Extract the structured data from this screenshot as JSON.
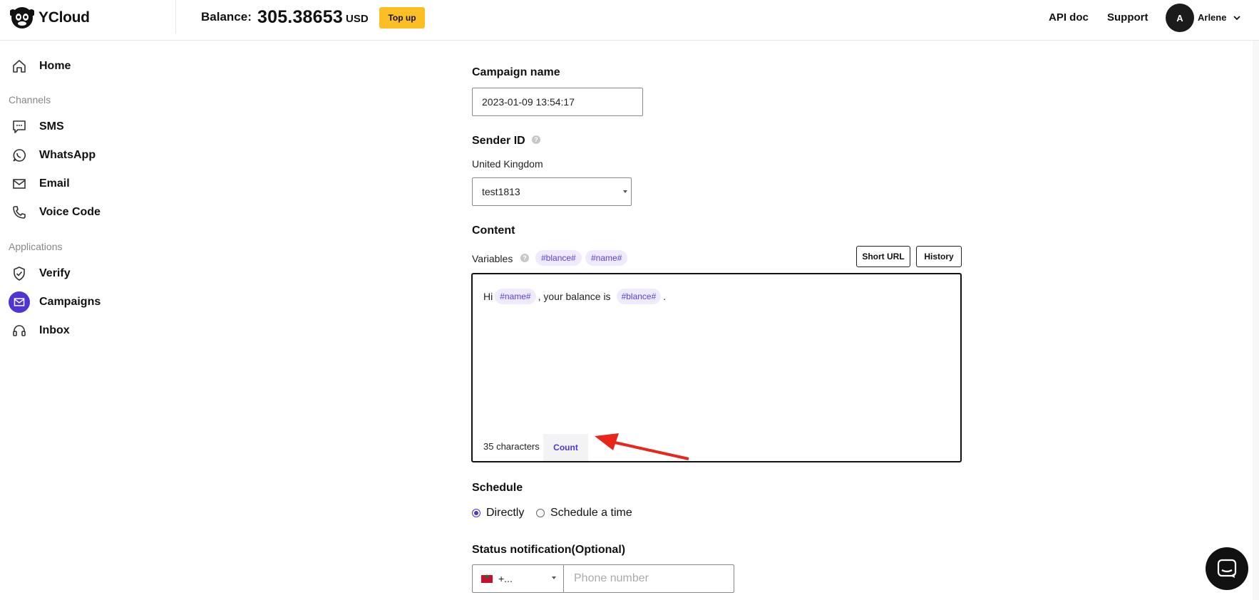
{
  "header": {
    "logo_text": "YCloud",
    "balance_label": "Balance:",
    "balance_value": "305.38653",
    "balance_currency": "USD",
    "topup_label": "Top up",
    "api_doc_label": "API doc",
    "support_label": "Support",
    "avatar_initial": "A",
    "user_name": "Arlene"
  },
  "sidebar": {
    "home": "Home",
    "channels_section": "Channels",
    "channels": [
      "SMS",
      "WhatsApp",
      "Email",
      "Voice Code"
    ],
    "applications_section": "Applications",
    "applications": [
      "Verify",
      "Campaigns",
      "Inbox"
    ],
    "active_item": "Campaigns"
  },
  "form": {
    "campaign_name_label": "Campaign name",
    "campaign_name_value": "2023-01-09 13:54:17",
    "sender_id_label": "Sender ID",
    "sender_country": "United Kingdom",
    "sender_value": "test1813",
    "content_label": "Content",
    "variables_label": "Variables",
    "variables": [
      "#blance#",
      "#name#"
    ],
    "short_url_label": "Short URL",
    "history_label": "History",
    "message": {
      "part1": "Hi",
      "chip1": "#name#",
      "part2": ", your balance is",
      "chip2": "#blance#",
      "part3": "."
    },
    "char_count": "35 characters",
    "count_label": "Count",
    "schedule_label": "Schedule",
    "schedule_options": [
      "Directly",
      "Schedule a time"
    ],
    "schedule_selected": "Directly",
    "status_label": "Status notification(Optional)",
    "country_code": "+...",
    "phone_placeholder": "Phone number"
  },
  "colors": {
    "accent": "#4f35d2",
    "topup": "#fbbf24",
    "chip_bg": "#efeaff",
    "annotation": "#e8261c"
  }
}
